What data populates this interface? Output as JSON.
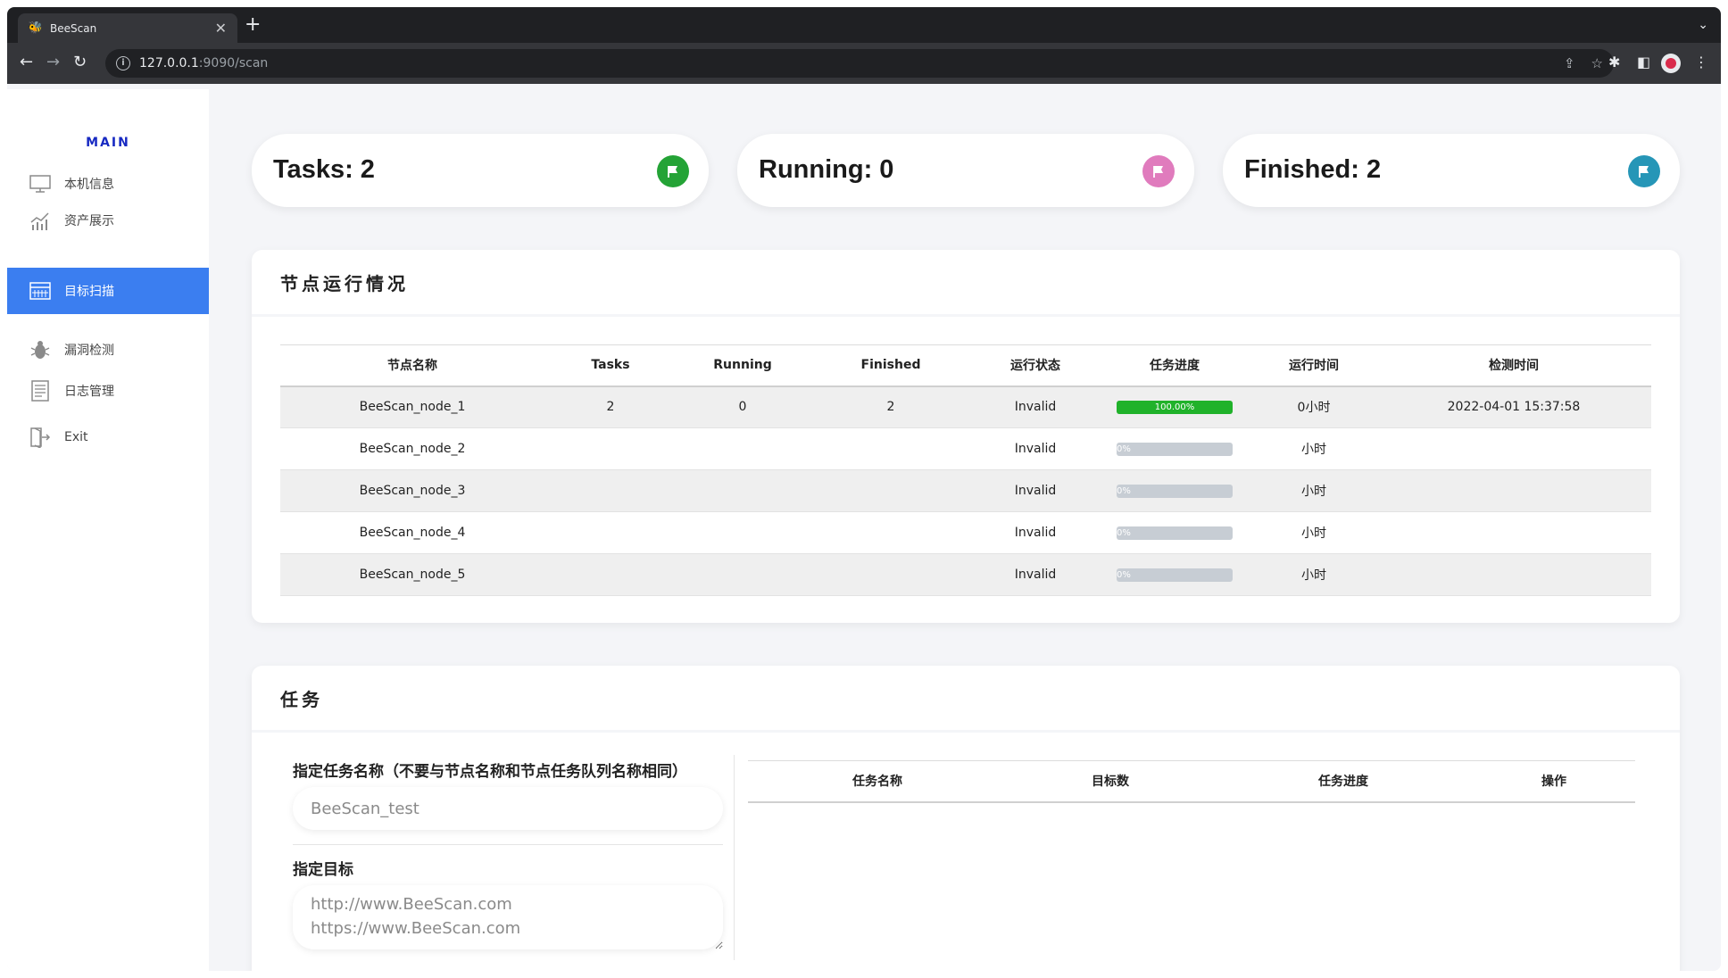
{
  "browser": {
    "tab_title": "BeeScan",
    "url_host": "127.0.0.1",
    "url_path": ":9090/scan"
  },
  "sidebar": {
    "brand": "MAIN",
    "items": [
      {
        "label": "本机信息",
        "icon": "monitor-icon"
      },
      {
        "label": "资产展示",
        "icon": "chart-icon"
      },
      {
        "label": "目标扫描",
        "icon": "calendar-grid-icon"
      },
      {
        "label": "漏洞检测",
        "icon": "bug-icon"
      },
      {
        "label": "日志管理",
        "icon": "document-icon"
      },
      {
        "label": "Exit",
        "icon": "exit-icon"
      }
    ],
    "active_index": 2
  },
  "stats": {
    "tasks": "Tasks: 2",
    "running": "Running: 0",
    "finished": "Finished: 2",
    "colors": {
      "tasks": "#24a336",
      "running": "#e07bbd",
      "finished": "#2696b7"
    }
  },
  "node_panel": {
    "title": "节点运行情况",
    "headers": [
      "节点名称",
      "Tasks",
      "Running",
      "Finished",
      "运行状态",
      "任务进度",
      "运行时间",
      "检测时间"
    ],
    "rows": [
      {
        "name": "BeeScan_node_1",
        "tasks": "2",
        "running": "0",
        "finished": "2",
        "status": "Invalid",
        "progress": 1.0,
        "progress_label": "100.00%",
        "run_time": "0小时",
        "check_time": "2022-04-01 15:37:58"
      },
      {
        "name": "BeeScan_node_2",
        "tasks": "",
        "running": "",
        "finished": "",
        "status": "Invalid",
        "progress": 0,
        "progress_label": "0%",
        "run_time": "小时",
        "check_time": ""
      },
      {
        "name": "BeeScan_node_3",
        "tasks": "",
        "running": "",
        "finished": "",
        "status": "Invalid",
        "progress": 0,
        "progress_label": "0%",
        "run_time": "小时",
        "check_time": ""
      },
      {
        "name": "BeeScan_node_4",
        "tasks": "",
        "running": "",
        "finished": "",
        "status": "Invalid",
        "progress": 0,
        "progress_label": "0%",
        "run_time": "小时",
        "check_time": ""
      },
      {
        "name": "BeeScan_node_5",
        "tasks": "",
        "running": "",
        "finished": "",
        "status": "Invalid",
        "progress": 0,
        "progress_label": "0%",
        "run_time": "小时",
        "check_time": ""
      }
    ]
  },
  "task_panel": {
    "title": "任务",
    "task_name_label": "指定任务名称（不要与节点名称和节点任务队列名称相同）",
    "task_name_placeholder": "BeeScan_test",
    "target_label": "指定目标",
    "target_placeholder": "http://www.BeeScan.com\nhttps://www.BeeScan.com\n...",
    "headers": [
      "任务名称",
      "目标数",
      "任务进度",
      "操作"
    ]
  }
}
